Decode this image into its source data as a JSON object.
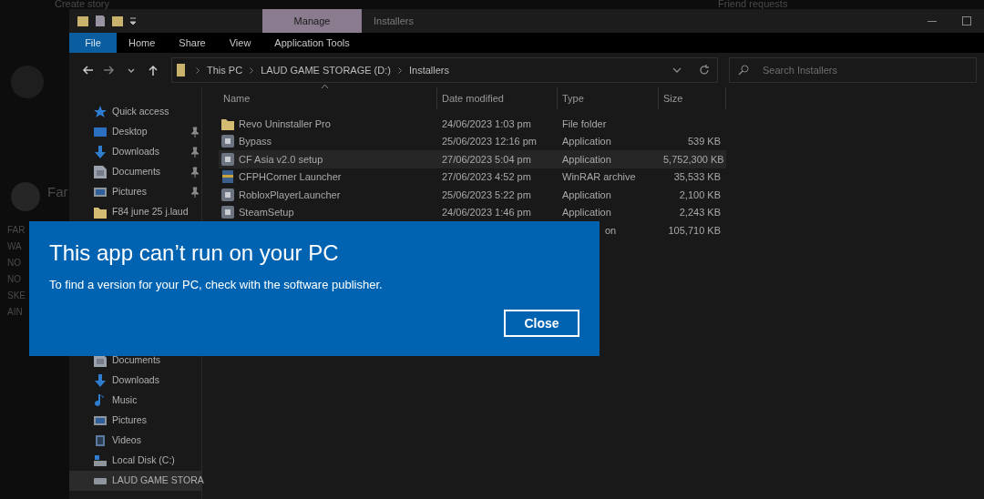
{
  "background": {
    "story_title": "Create story",
    "friend_requests": "Friend requests",
    "poster_name": "Far",
    "post_lines": [
      "FAR",
      "WA",
      "NO",
      "NO",
      "SKE",
      "AIN"
    ]
  },
  "window": {
    "context_tab": "Manage",
    "title": "Installers"
  },
  "ribbon_tabs": [
    {
      "label": "File",
      "selected": true
    },
    {
      "label": "Home",
      "selected": false
    },
    {
      "label": "Share",
      "selected": false
    },
    {
      "label": "View",
      "selected": false
    },
    {
      "label": "Application Tools",
      "selected": false
    }
  ],
  "address": {
    "crumbs": [
      "This PC",
      "LAUD GAME STORAGE (D:)",
      "Installers"
    ]
  },
  "search": {
    "placeholder": "Search Installers"
  },
  "nav": [
    {
      "label": "Quick access",
      "kind": "star",
      "pinned": false,
      "selected": false
    },
    {
      "label": "Desktop",
      "kind": "desktop",
      "pinned": true,
      "selected": false
    },
    {
      "label": "Downloads",
      "kind": "download",
      "pinned": true,
      "selected": false
    },
    {
      "label": "Documents",
      "kind": "document",
      "pinned": true,
      "selected": false
    },
    {
      "label": "Pictures",
      "kind": "pictures",
      "pinned": true,
      "selected": false
    },
    {
      "label": "F84 june 25 j.laud",
      "kind": "folder",
      "pinned": false,
      "selected": false
    },
    {
      "kind": "gap"
    },
    {
      "label": "Documents",
      "kind": "document",
      "pinned": false,
      "selected": false
    },
    {
      "label": "Downloads",
      "kind": "download",
      "pinned": false,
      "selected": false
    },
    {
      "label": "Music",
      "kind": "music",
      "pinned": false,
      "selected": false
    },
    {
      "label": "Pictures",
      "kind": "pictures",
      "pinned": false,
      "selected": false
    },
    {
      "label": "Videos",
      "kind": "videos",
      "pinned": false,
      "selected": false
    },
    {
      "label": "Local Disk (C:)",
      "kind": "disk",
      "pinned": false,
      "selected": false
    },
    {
      "label": "LAUD GAME STORA",
      "kind": "drive",
      "pinned": false,
      "selected": true
    }
  ],
  "table": {
    "columns": [
      "Name",
      "Date modified",
      "Type",
      "Size"
    ],
    "rows": [
      {
        "kind": "folder",
        "name": "Revo Uninstaller Pro",
        "date": "24/06/2023 1:03 pm",
        "type": "File folder",
        "selected": false
      },
      {
        "kind": "app",
        "name": "Bypass",
        "date": "25/06/2023 12:16 pm",
        "type": "Application",
        "size": "539 KB",
        "selected": false
      },
      {
        "kind": "app",
        "name": "CF Asia v2.0 setup",
        "date": "27/06/2023 5:04 pm",
        "type": "Application",
        "size": "5,752,300 KB",
        "selected": true
      },
      {
        "kind": "archive",
        "name": "CFPHCorner Launcher",
        "date": "27/06/2023 4:52 pm",
        "type": "WinRAR archive",
        "size": "35,533 KB",
        "selected": false
      },
      {
        "kind": "app",
        "name": "RobloxPlayerLauncher",
        "date": "25/06/2023 5:22 pm",
        "type": "Application",
        "size": "2,100 KB",
        "selected": false
      },
      {
        "kind": "app",
        "name": "SteamSetup",
        "date": "24/06/2023 1:46 pm",
        "type": "Application",
        "size": "2,243 KB",
        "selected": false
      },
      {
        "kind": "covered",
        "type": "on",
        "size": "105,710 KB",
        "selected": false
      }
    ]
  },
  "dialog": {
    "title": "This app can’t run on your PC",
    "message": "To find a version for your PC, check with the software publisher.",
    "button": "Close"
  }
}
